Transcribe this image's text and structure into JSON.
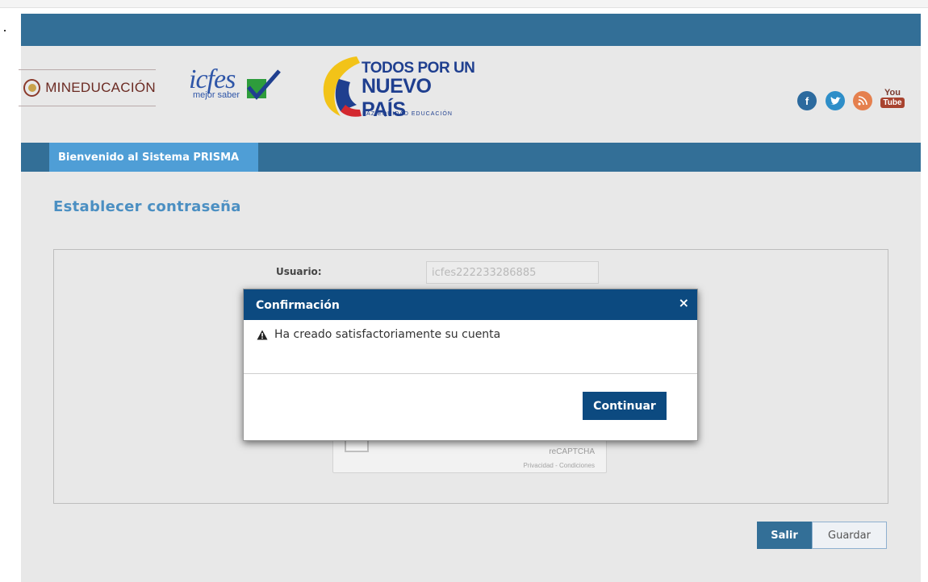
{
  "header": {
    "mineducacion": "MINEDUCACIÓN",
    "icfes_word": "icfes",
    "icfes_sub": "mejor saber",
    "todos_line1": "TODOS POR UN",
    "todos_line2": "NUEVO PAÍS",
    "todos_line3": "PAZ  EQUIDAD  EDUCACIÓN",
    "social": {
      "facebook": "f",
      "twitter": "t",
      "rss": "r",
      "youtube_you": "You",
      "youtube_tube": "Tube"
    }
  },
  "nav": {
    "active_tab": "Bienvenido al Sistema PRISMA"
  },
  "page": {
    "title": "Establecer contraseña"
  },
  "form": {
    "usuario_label": "Usuario:",
    "usuario_value": "icfes222233286885"
  },
  "recaptcha": {
    "label": "reCAPTCHA",
    "links": "Privacidad - Condiciones"
  },
  "actions": {
    "salir": "Salir",
    "guardar": "Guardar"
  },
  "modal": {
    "title": "Confirmación",
    "close": "×",
    "message": "Ha creado satisfactoriamente su cuenta",
    "continue": "Continuar"
  },
  "colors": {
    "header_bar": "#336f97",
    "nav_tab": "#4f9ed6",
    "modal_header": "#0c4a80",
    "title_blue": "#4b8fc2"
  }
}
